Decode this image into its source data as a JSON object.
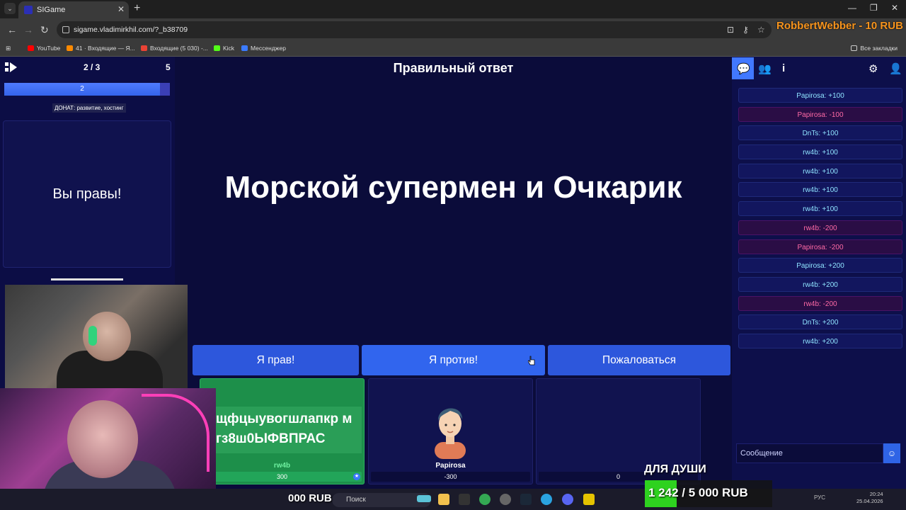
{
  "browser": {
    "tab_title": "SIGame",
    "url": "sigame.vladimirkhil.com/?_b38709",
    "bookmarks": [
      {
        "label": "YouTube",
        "color": "#ff0000"
      },
      {
        "label": "41 · Входящие — Я...",
        "color": "#ff8a00"
      },
      {
        "label": "Входящие (5 030) -...",
        "color": "#ea4335"
      },
      {
        "label": "Kick",
        "color": "#53fc18"
      },
      {
        "label": "Мессенджер",
        "color": "#3b7bff"
      }
    ],
    "all_bookmarks": "Все закладки"
  },
  "stream_overlay": {
    "donor_line": "RobbertWebber - 10 RUB",
    "rub_left": "000 RUB",
    "goal_title": "ДЛЯ ДУШИ",
    "goal_text": "1 242 / 5 000 RUB",
    "goal_progress": 0.2484
  },
  "game": {
    "round_progress": "2 / 3",
    "round_count": "5",
    "timer_value": "2",
    "timer_progress": 0.94,
    "donate_label": "ДОНАТ: развитие, хостинг",
    "answer_card_text": "Вы правы!",
    "header_title": "Правильный ответ",
    "question_text": "Морской супермен и Очкарик",
    "buttons": {
      "right": "Я прав!",
      "against": "Я против!",
      "complain": "Пожаловаться"
    },
    "players": [
      {
        "name": "rw4b",
        "score": "300",
        "image_text": "щфцыувогшлапкр м гз8ш0ЫФВПРАС"
      },
      {
        "name": "Papirosa",
        "score": "-300"
      },
      {
        "name": "",
        "score": "0"
      }
    ]
  },
  "chat": {
    "messages": [
      {
        "text": "Papirosa: +100",
        "negative": false
      },
      {
        "text": "Papirosa: -100",
        "negative": true
      },
      {
        "text": "DnTs: +100",
        "negative": false
      },
      {
        "text": "rw4b: +100",
        "negative": false
      },
      {
        "text": "rw4b: +100",
        "negative": false
      },
      {
        "text": "rw4b: +100",
        "negative": false
      },
      {
        "text": "rw4b: +100",
        "negative": false
      },
      {
        "text": "rw4b: -200",
        "negative": true
      },
      {
        "text": "Papirosa: -200",
        "negative": true
      },
      {
        "text": "Papirosa: +200",
        "negative": false
      },
      {
        "text": "rw4b: +200",
        "negative": false
      },
      {
        "text": "rw4b: -200",
        "negative": true
      },
      {
        "text": "DnTs: +200",
        "negative": false
      },
      {
        "text": "rw4b: +200",
        "negative": false
      }
    ],
    "input_placeholder": "Сообщение"
  },
  "taskbar": {
    "search_label": "Поиск",
    "lang": "РУС",
    "time": "20:24",
    "date": "25.04.2026"
  }
}
